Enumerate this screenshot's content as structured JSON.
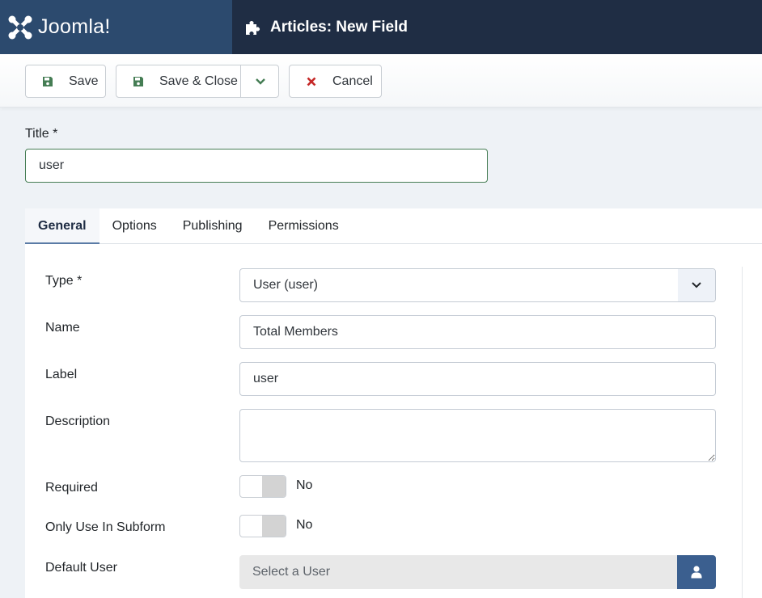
{
  "header": {
    "brand": "Joomla!",
    "page_title": "Articles: New Field",
    "page_icon": "puzzle-icon"
  },
  "toolbar": {
    "save_label": "Save",
    "save_close_label": "Save & Close",
    "cancel_label": "Cancel",
    "colors": {
      "save_icon": "#457d54",
      "cancel_icon": "#c52827"
    }
  },
  "title_field": {
    "label": "Title *",
    "value": "user"
  },
  "tabs": [
    {
      "label": "General",
      "active": true
    },
    {
      "label": "Options",
      "active": false
    },
    {
      "label": "Publishing",
      "active": false
    },
    {
      "label": "Permissions",
      "active": false
    }
  ],
  "form": {
    "type": {
      "label": "Type *",
      "value": "User (user)"
    },
    "name": {
      "label": "Name",
      "value": "Total Members"
    },
    "field_label": {
      "label": "Label",
      "value": "user"
    },
    "description": {
      "label": "Description",
      "value": ""
    },
    "required": {
      "label": "Required",
      "value": "No"
    },
    "only_use_in_subform": {
      "label": "Only Use In Subform",
      "value": "No"
    },
    "default_user": {
      "label": "Default User",
      "placeholder": "Select a User"
    }
  },
  "colors": {
    "header_bg": "#1f2d44",
    "brand_bg": "#2c4a6e",
    "accent": "#3b5f8f",
    "page_bg": "#eef2f6"
  }
}
